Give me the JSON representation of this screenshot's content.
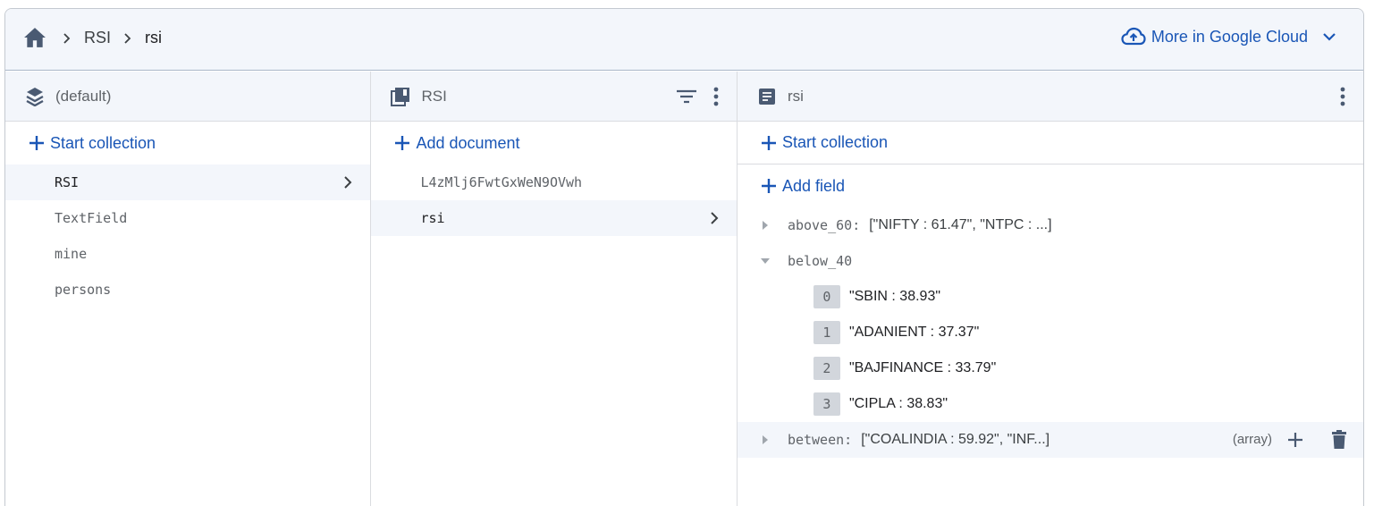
{
  "breadcrumb": {
    "home_icon": "home-icon",
    "items": [
      "RSI",
      "rsi"
    ]
  },
  "google_cloud": {
    "label": "More in Google Cloud",
    "icon": "cloud-upload-icon"
  },
  "colors": {
    "accent": "#1a56b6",
    "header_bg": "#f3f6fb",
    "index_bg": "#d2d6dc"
  },
  "database_panel": {
    "title": "(default)",
    "action": "Start collection",
    "collections": [
      "RSI",
      "TextField",
      "mine",
      "persons"
    ],
    "selected": "RSI"
  },
  "collection_panel": {
    "title": "RSI",
    "action": "Add document",
    "documents": [
      "L4zMlj6FwtGxWeN9OVwh",
      "rsi"
    ],
    "selected": "rsi"
  },
  "document_panel": {
    "title": "rsi",
    "action_collection": "Start collection",
    "action_field": "Add field",
    "fields": {
      "above_60": {
        "name": "above_60",
        "colon": ":",
        "preview": "[\"NIFTY : 61.47\", \"NTPC : ...]"
      },
      "below_40": {
        "name": "below_40",
        "items": [
          {
            "index": "0",
            "value": "\"SBIN : 38.93\""
          },
          {
            "index": "1",
            "value": "\"ADANIENT : 37.37\""
          },
          {
            "index": "2",
            "value": "\"BAJFINANCE : 33.79\""
          },
          {
            "index": "3",
            "value": "\"CIPLA : 38.83\""
          }
        ]
      },
      "between": {
        "name": "between",
        "colon": ":",
        "preview": "[\"COALINDIA : 59.92\", \"INF...]",
        "type": "(array)"
      }
    }
  }
}
